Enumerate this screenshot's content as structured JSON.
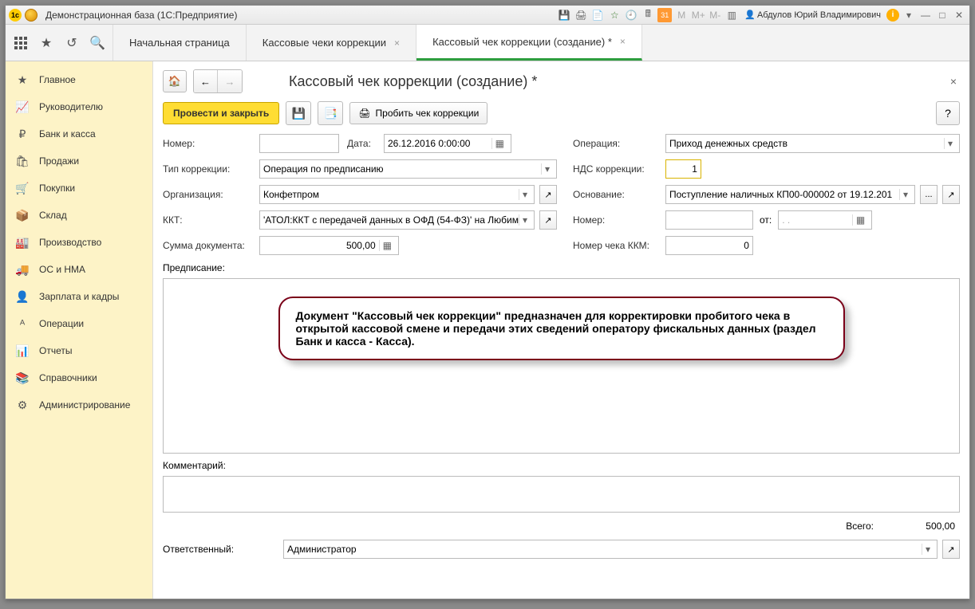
{
  "titlebar": {
    "app_title": "Демонстрационная база  (1С:Предприятие)",
    "user_name": "Абдулов Юрий Владимирович",
    "cal_day": "31",
    "m_label": "M",
    "m_plus": "M+",
    "m_minus": "M-"
  },
  "tabs": {
    "start": "Начальная страница",
    "t1": "Кассовые чеки коррекции",
    "t2": "Кассовый чек коррекции (создание) *"
  },
  "sidebar": [
    {
      "icon": "★",
      "label": "Главное"
    },
    {
      "icon": "📈",
      "label": "Руководителю"
    },
    {
      "icon": "₽",
      "label": "Банк и касса"
    },
    {
      "icon": "🛍",
      "label": "Продажи"
    },
    {
      "icon": "🛒",
      "label": "Покупки"
    },
    {
      "icon": "📦",
      "label": "Склад"
    },
    {
      "icon": "🏭",
      "label": "Производство"
    },
    {
      "icon": "🚚",
      "label": "ОС и НМА"
    },
    {
      "icon": "👤",
      "label": "Зарплата и кадры"
    },
    {
      "icon": "ᴬ",
      "label": "Операции"
    },
    {
      "icon": "📊",
      "label": "Отчеты"
    },
    {
      "icon": "📚",
      "label": "Справочники"
    },
    {
      "icon": "⚙",
      "label": "Администрирование"
    }
  ],
  "doc": {
    "title": "Кассовый чек коррекции (создание) *",
    "btn_post_close": "Провести и закрыть",
    "btn_print_check": "Пробить чек коррекции",
    "help": "?"
  },
  "form": {
    "number_lbl": "Номер:",
    "number_val": "",
    "date_lbl": "Дата:",
    "date_val": "26.12.2016  0:00:00",
    "corr_type_lbl": "Тип коррекции:",
    "corr_type_val": "Операция по предписанию",
    "org_lbl": "Организация:",
    "org_val": "Конфетпром",
    "kkt_lbl": "ККТ:",
    "kkt_val": "'АТОЛ:ККТ с передачей данных в ОФД (54-ФЗ)' на Любим",
    "sum_lbl": "Сумма документа:",
    "sum_val": "500,00",
    "operation_lbl": "Операция:",
    "operation_val": "Приход денежных средств",
    "nds_lbl": "НДС коррекции:",
    "nds_val": "1",
    "basis_lbl": "Основание:",
    "basis_val": "Поступление наличных КП00-000002 от 19.12.201",
    "basis_number_lbl": "Номер:",
    "basis_number_val": "",
    "basis_from_lbl": "от:",
    "basis_from_val": ".   .",
    "kkm_check_lbl": "Номер чека ККМ:",
    "kkm_check_val": "0",
    "prescription_lbl": "Предписание:",
    "comment_lbl": "Комментарий:",
    "total_lbl": "Всего:",
    "total_val": "500,00",
    "responsible_lbl": "Ответственный:",
    "responsible_val": "Администратор",
    "dots": "..."
  },
  "callout_text": "Документ \"Кассовый чек коррекции\" предназначен для корректировки пробитого чека в открытой кассовой смене и передачи этих сведений оператору фискальных данных  (раздел Банк и касса - Касса)."
}
